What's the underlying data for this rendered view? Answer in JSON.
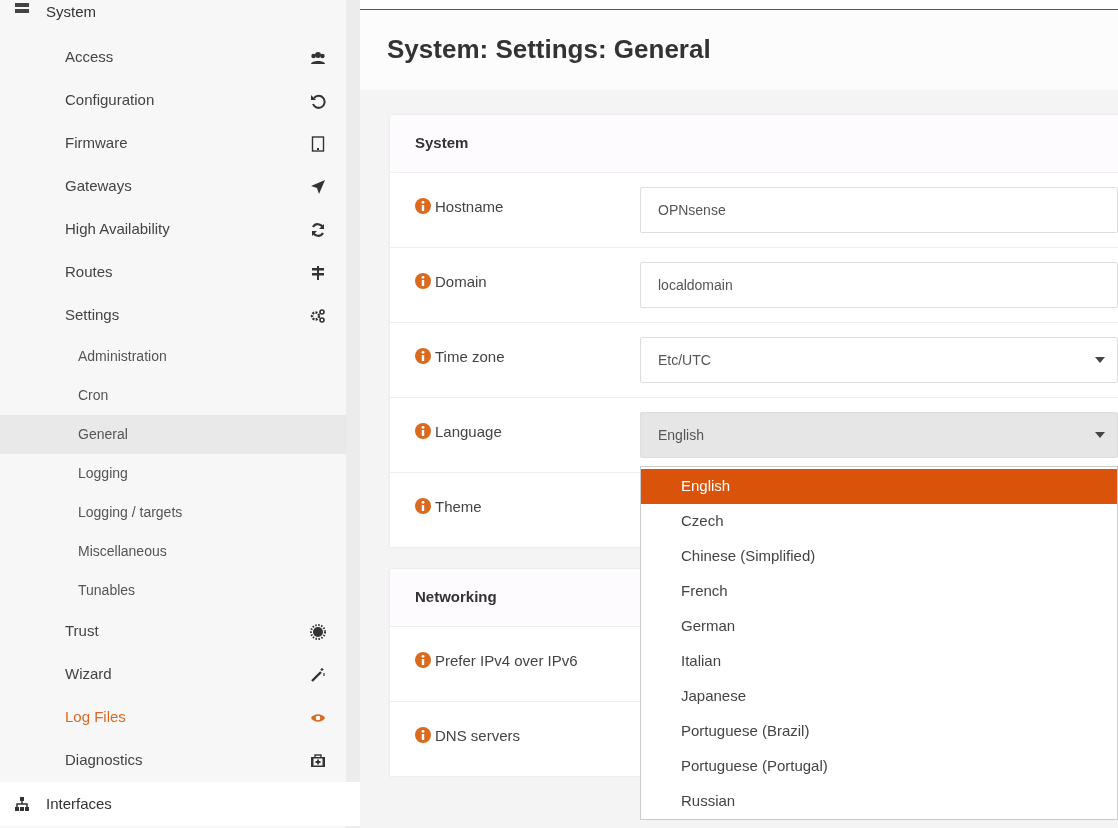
{
  "sidebar": {
    "section": {
      "label": "System"
    },
    "items": [
      {
        "label": "Access",
        "selected": false,
        "hovered": false
      },
      {
        "label": "Configuration",
        "selected": false,
        "hovered": false
      },
      {
        "label": "Firmware",
        "selected": false,
        "hovered": false
      },
      {
        "label": "Gateways",
        "selected": false,
        "hovered": false
      },
      {
        "label": "High Availability",
        "selected": false,
        "hovered": false
      },
      {
        "label": "Routes",
        "selected": false,
        "hovered": false
      },
      {
        "label": "Settings",
        "selected": false,
        "hovered": false,
        "children": [
          {
            "label": "Administration",
            "selected": false
          },
          {
            "label": "Cron",
            "selected": false
          },
          {
            "label": "General",
            "selected": true
          },
          {
            "label": "Logging",
            "selected": false
          },
          {
            "label": "Logging / targets",
            "selected": false
          },
          {
            "label": "Miscellaneous",
            "selected": false
          },
          {
            "label": "Tunables",
            "selected": false
          }
        ]
      },
      {
        "label": "Trust",
        "selected": false,
        "hovered": false
      },
      {
        "label": "Wizard",
        "selected": false,
        "hovered": false
      },
      {
        "label": "Log Files",
        "selected": false,
        "hovered": true
      },
      {
        "label": "Diagnostics",
        "selected": false,
        "hovered": false
      }
    ],
    "next_section": {
      "label": "Interfaces"
    }
  },
  "page_title": "System: Settings: General",
  "sections": [
    {
      "title": "System",
      "rows": [
        {
          "label": "Hostname",
          "kind": "text",
          "value": "OPNsense"
        },
        {
          "label": "Domain",
          "kind": "text",
          "value": "localdomain"
        },
        {
          "label": "Time zone",
          "kind": "select",
          "value": "Etc/UTC",
          "open": false
        },
        {
          "label": "Language",
          "kind": "select",
          "value": "English",
          "open": true,
          "options": [
            {
              "label": "English",
              "selected": true
            },
            {
              "label": "Czech",
              "selected": false
            },
            {
              "label": "Chinese (Simplified)",
              "selected": false
            },
            {
              "label": "French",
              "selected": false
            },
            {
              "label": "German",
              "selected": false
            },
            {
              "label": "Italian",
              "selected": false
            },
            {
              "label": "Japanese",
              "selected": false
            },
            {
              "label": "Portuguese (Brazil)",
              "selected": false
            },
            {
              "label": "Portuguese (Portugal)",
              "selected": false
            },
            {
              "label": "Russian",
              "selected": false
            }
          ]
        },
        {
          "label": "Theme",
          "kind": "hidden"
        }
      ]
    },
    {
      "title": "Networking",
      "rows": [
        {
          "label": "Prefer IPv4 over IPv6",
          "kind": "hidden"
        },
        {
          "label": "DNS servers",
          "kind": "hidden"
        }
      ]
    }
  ]
}
